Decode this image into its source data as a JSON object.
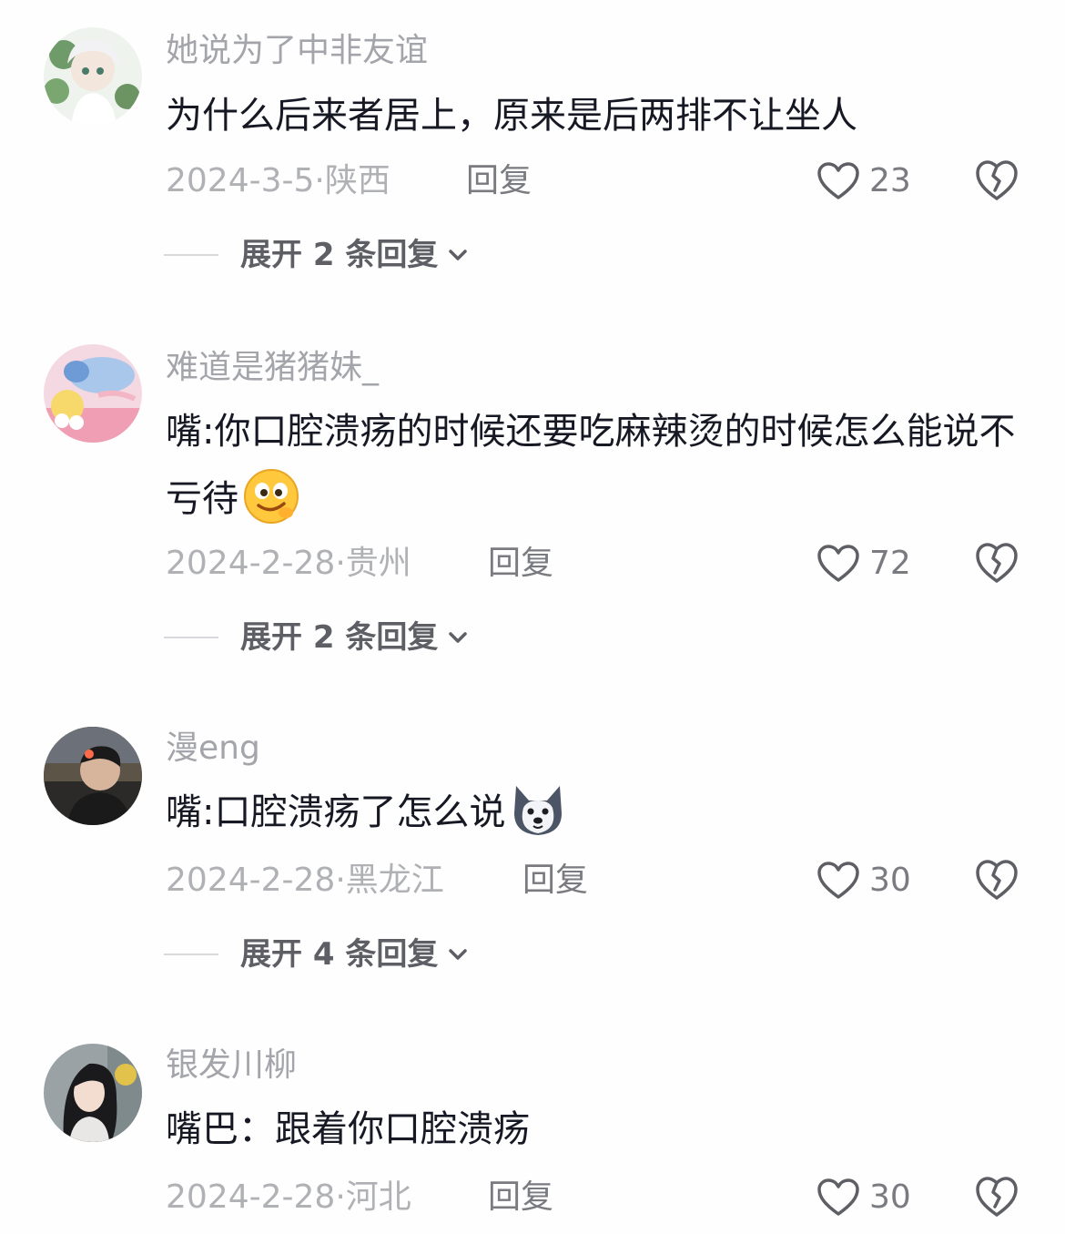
{
  "comments": [
    {
      "username": "她说为了中非友谊",
      "content": "为什么后来者居上，原来是后两排不让坐人",
      "date": "2024-3-5",
      "region": "陕西",
      "reply_label": "回复",
      "likes": "23",
      "expand_label": "展开 2 条回复"
    },
    {
      "username": "难道是猪猪妹_",
      "content": "嘴:你口腔溃疡的时候还要吃麻辣烫的时候怎么能说不亏待",
      "emoji": "smirk-emoji",
      "date": "2024-2-28",
      "region": "贵州",
      "reply_label": "回复",
      "likes": "72",
      "expand_label": "展开 2 条回复"
    },
    {
      "username": "漫eng",
      "content": "嘴:口腔溃疡了怎么说",
      "emoji": "husky-emoji",
      "date": "2024-2-28",
      "region": "黑龙江",
      "reply_label": "回复",
      "likes": "30",
      "expand_label": "展开 4 条回复"
    },
    {
      "username": "银发川柳",
      "content": "嘴巴：跟着你口腔溃疡",
      "date": "2024-2-28",
      "region": "河北",
      "reply_label": "回复",
      "likes": "30"
    }
  ],
  "icons": {
    "like": "heart-outline-icon",
    "dislike": "broken-heart-icon",
    "expand": "chevron-down-icon"
  },
  "colors": {
    "username": "#a4a5aa",
    "content": "#161823",
    "meta": "#b0b1b5",
    "action": "#7a7b80",
    "expand": "#5e5f65"
  }
}
